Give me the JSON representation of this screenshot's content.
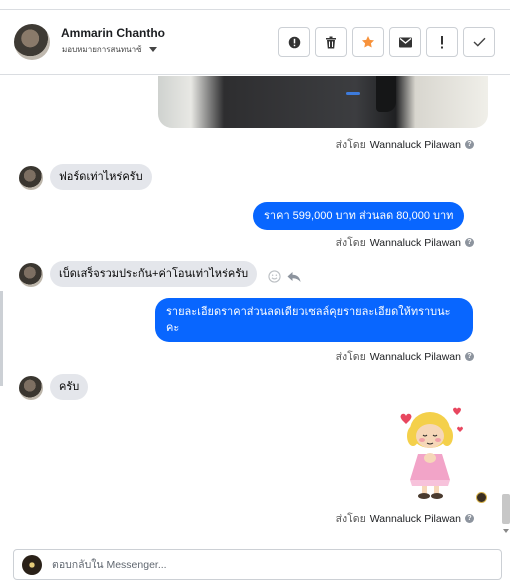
{
  "header": {
    "contact_name": "Ammarin Chantho",
    "assign_label": "มอบหมายการสนทนาซ้",
    "actions": [
      {
        "icon": "alert-circle-icon"
      },
      {
        "icon": "trash-icon"
      },
      {
        "icon": "star-icon",
        "color": "#f7923b"
      },
      {
        "icon": "mail-icon"
      },
      {
        "icon": "exclamation-icon"
      },
      {
        "icon": "check-icon"
      }
    ]
  },
  "sent_by_prefix": "ส่งโดย",
  "agent_name": "Wannaluck Pilawan",
  "help_glyph": "?",
  "messages": [
    {
      "from": "customer",
      "text": "ฟอร์ดเท่าไหร่ครับ"
    },
    {
      "from": "page",
      "text": "ราคา 599,000 บาท  ส่วนลด 80,000  บาท"
    },
    {
      "from": "customer",
      "text": "เบ็ดเสร็จรวมประกัน+ค่าโอนเท่าไหร่ครับ"
    },
    {
      "from": "page",
      "line1": "รายละเอียดราคาส่วนลดเดียวเซลล์คุยรายละเอียดให้ทราบนะ",
      "line2": "คะ"
    },
    {
      "from": "customer",
      "text": "ครับ"
    }
  ],
  "composer": {
    "placeholder": "ตอบกลับใน Messenger..."
  },
  "colors": {
    "accent": "#0866ff",
    "incoming_bubble": "#e4e6eb",
    "star": "#f7923b"
  }
}
